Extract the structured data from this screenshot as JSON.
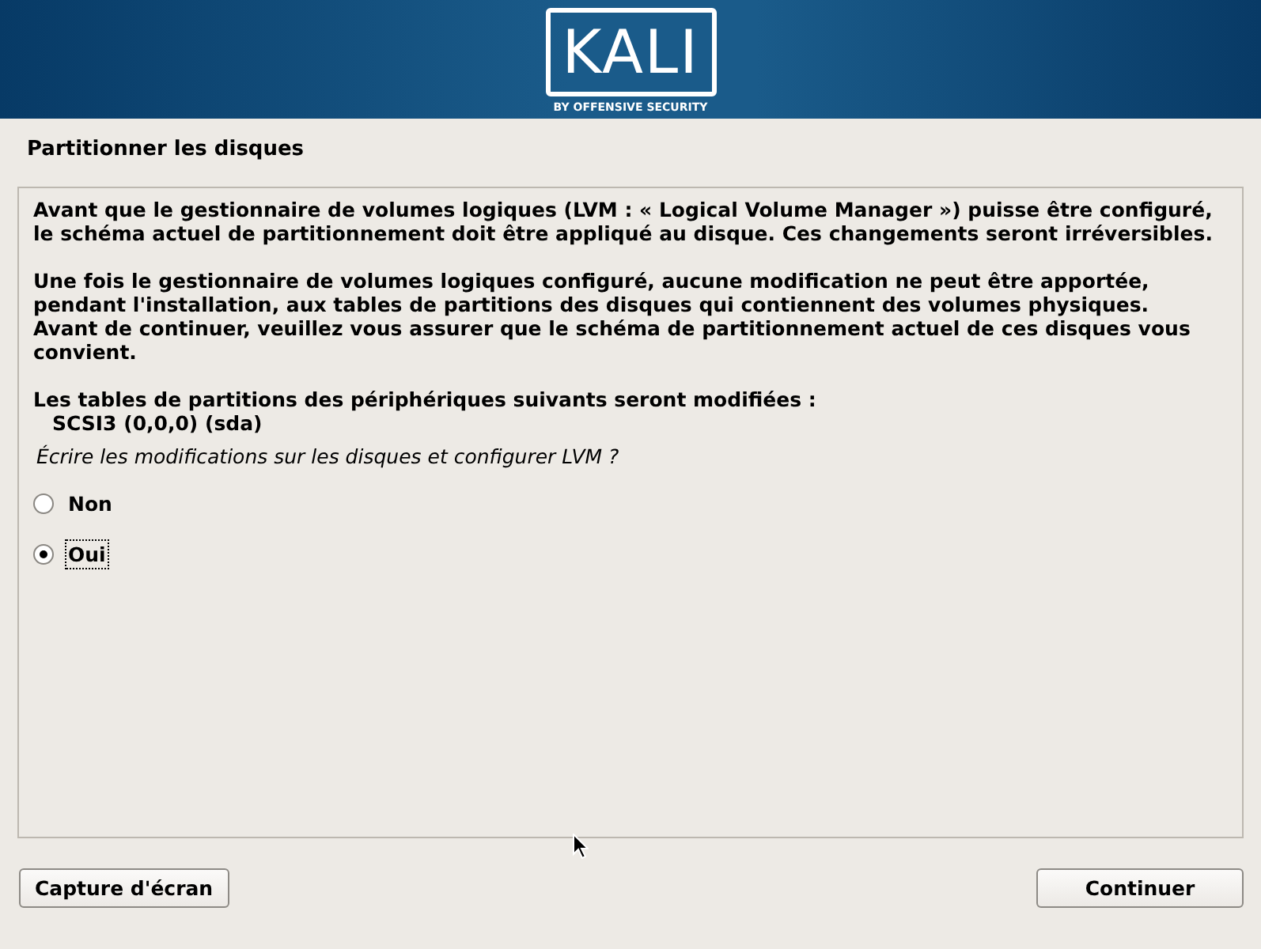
{
  "banner": {
    "logo_text": "KALI",
    "logo_tagline": "BY OFFENSIVE SECURITY"
  },
  "title": "Partitionner les disques",
  "paragraphs": [
    "Avant que le gestionnaire de volumes logiques (LVM : « Logical Volume Manager ») puisse être configuré,\nle schéma actuel de partitionnement doit être appliqué au disque. Ces changements seront irréversibles.",
    "Une fois le gestionnaire de volumes logiques configuré, aucune modification ne peut être apportée,\npendant l'installation, aux tables de partitions des disques qui contiennent des volumes physiques.\nAvant de continuer, veuillez vous assurer que le schéma de partitionnement actuel de ces disques vous\nconvient."
  ],
  "devices_heading": "Les tables de partitions des périphériques suivants seront modifiées :",
  "devices": [
    "SCSI3 (0,0,0) (sda)"
  ],
  "question": "Écrire les modifications sur les disques et configurer LVM ?",
  "options": [
    {
      "label": "Non",
      "selected": false
    },
    {
      "label": "Oui",
      "selected": true
    }
  ],
  "buttons": {
    "left": "Capture d'écran",
    "right": "Continuer"
  }
}
